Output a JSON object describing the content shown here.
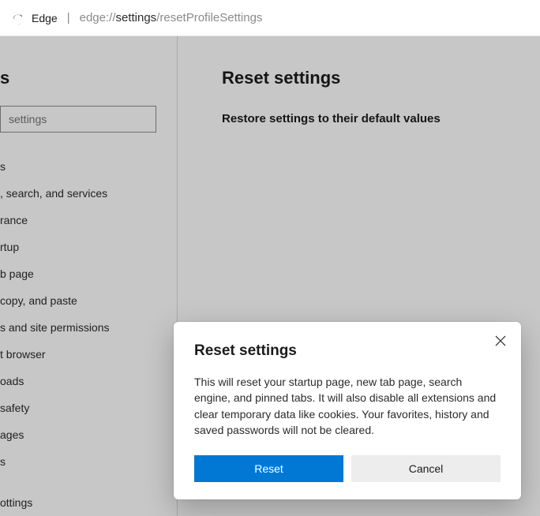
{
  "addressBar": {
    "appName": "Edge",
    "url_prefix": "edge://",
    "url_middle": "settings",
    "url_suffix": "/resetProfileSettings"
  },
  "sidebar": {
    "title_fragment": "s",
    "search_placeholder": "settings",
    "items": [
      "s",
      ", search, and services",
      "rance",
      "rtup",
      "b page",
      "copy, and paste",
      "s and site permissions",
      "t browser",
      "oads",
      "safety",
      "ages",
      "s",
      "",
      "ottings"
    ]
  },
  "main": {
    "title": "Reset settings",
    "subheading": "Restore settings to their default values"
  },
  "dialog": {
    "title": "Reset settings",
    "body": "This will reset your startup page, new tab page, search engine, and pinned tabs. It will also disable all extensions and clear temporary data like cookies. Your favorites, history and saved passwords will not be cleared.",
    "primary": "Reset",
    "secondary": "Cancel"
  }
}
